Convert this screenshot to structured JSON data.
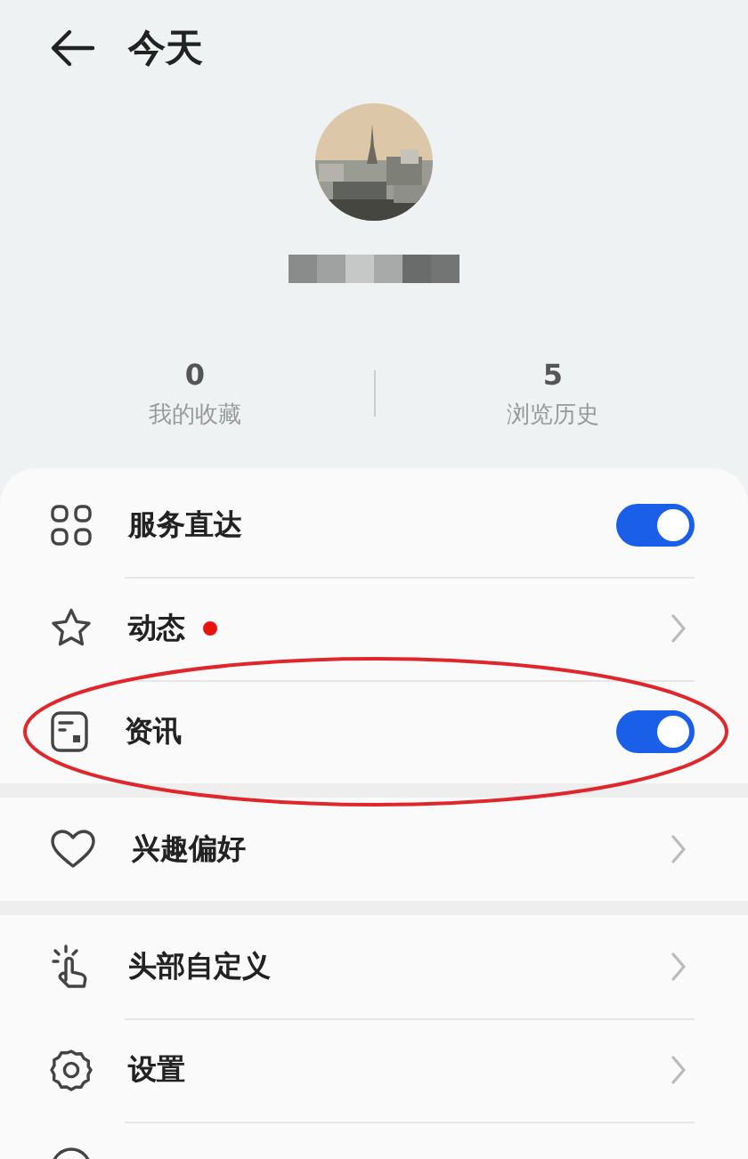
{
  "header": {
    "title": "今天"
  },
  "stats": [
    {
      "value": "0",
      "label": "我的收藏"
    },
    {
      "value": "5",
      "label": "浏览历史"
    }
  ],
  "groups": [
    {
      "items": [
        {
          "kind": "toggle",
          "label": "服务直达",
          "on": true,
          "circled": false
        },
        {
          "kind": "link",
          "label": "动态",
          "dot": true,
          "circled": false
        },
        {
          "kind": "toggle",
          "label": "资讯",
          "on": true,
          "circled": true
        }
      ]
    },
    {
      "items": [
        {
          "kind": "link",
          "label": "兴趣偏好",
          "dot": false,
          "circled": false
        }
      ]
    },
    {
      "items": [
        {
          "kind": "link",
          "label": "头部自定义",
          "dot": false,
          "circled": false
        },
        {
          "kind": "link",
          "label": "设置",
          "dot": false,
          "circled": false
        },
        {
          "kind": "partial",
          "circled": false
        }
      ]
    }
  ]
}
